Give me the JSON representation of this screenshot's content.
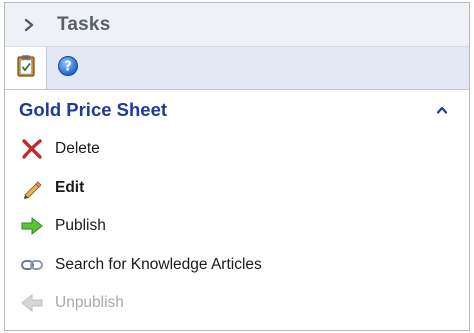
{
  "header": {
    "title": "Tasks",
    "expand_icon": "chevron-right-icon"
  },
  "toolbar": {
    "tools": [
      {
        "icon": "clipboard-icon",
        "active": true
      },
      {
        "icon": "help-icon",
        "active": false
      }
    ]
  },
  "section": {
    "title": "Gold Price Sheet",
    "collapse_icon": "chevron-up-icon",
    "items": [
      {
        "label": "Delete",
        "icon": "delete-x-icon",
        "color": "#c62828"
      },
      {
        "label": "Edit",
        "icon": "pencil-icon",
        "bold": true
      },
      {
        "label": "Publish",
        "icon": "arrow-right-icon",
        "color": "#4caf24"
      },
      {
        "label": "Search for Knowledge Articles",
        "icon": "link-icon"
      },
      {
        "label": "Unpublish",
        "icon": "arrow-left-icon",
        "disabled": true
      }
    ]
  },
  "colors": {
    "accent": "#1f3a9e",
    "header_bg": "#eef1f6",
    "toolbar_bg": "#e3e8f4",
    "disabled_text": "#a9a9a9"
  }
}
